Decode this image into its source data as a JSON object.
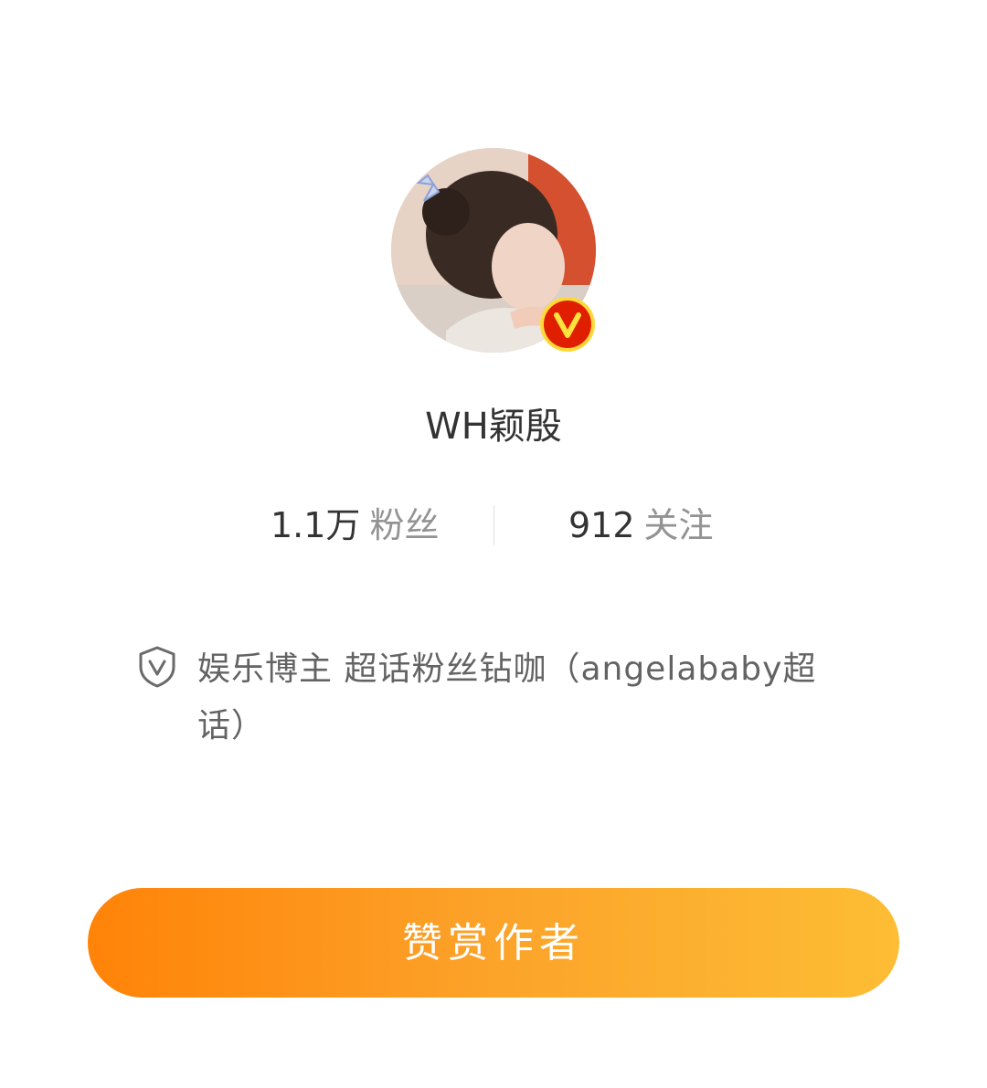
{
  "profile": {
    "nickname": "WH颖殷",
    "verified": true,
    "avatar_description": "profile photo"
  },
  "stats": {
    "fans_count": "1.1万",
    "fans_label": "粉丝",
    "follow_count": "912",
    "follow_label": "关注"
  },
  "certification": {
    "icon": "shield-v-icon",
    "text": "娱乐博主 超话粉丝钻咖（angelababy超话）"
  },
  "reward_button": {
    "label": "赞赏作者"
  },
  "colors": {
    "button_gradient_start": "#ff8308",
    "button_gradient_end": "#fdbd34",
    "verified_badge": "#e01e00",
    "verified_badge_ring": "#ffd83a"
  }
}
